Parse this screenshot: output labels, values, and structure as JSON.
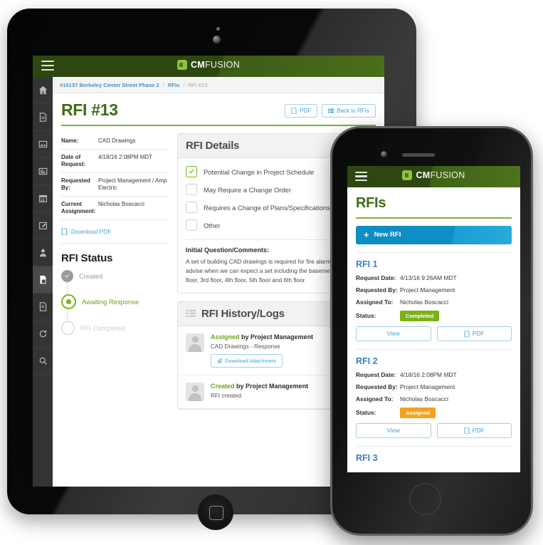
{
  "brand": {
    "name_bold": "CM",
    "name_light": "FUSION",
    "green_dark": "#2e4710",
    "green_accent": "#7fb03a",
    "blue": "#45a3d8",
    "orange": "#f5a11d"
  },
  "tablet": {
    "topbar": {
      "menu_icon": "hamburger-icon",
      "logo_icon": "cmfusion-logo-icon"
    },
    "sidebar": [
      {
        "name": "home",
        "icon": "home-icon",
        "active": false
      },
      {
        "name": "documents",
        "icon": "document-icon",
        "active": false
      },
      {
        "name": "photos",
        "icon": "image-icon",
        "active": false
      },
      {
        "name": "submittals",
        "icon": "list-icon",
        "active": false
      },
      {
        "name": "schedule",
        "icon": "calendar-icon",
        "active": false
      },
      {
        "name": "daily-logs",
        "icon": "edit-icon",
        "active": false
      },
      {
        "name": "contacts",
        "icon": "user-icon",
        "active": false
      },
      {
        "name": "rfis",
        "icon": "rfi-icon",
        "active": true
      },
      {
        "name": "forms",
        "icon": "file-icon",
        "active": false
      },
      {
        "name": "change-orders",
        "icon": "refresh-icon",
        "active": false
      },
      {
        "name": "search",
        "icon": "search-icon",
        "active": false
      }
    ],
    "breadcrumb": {
      "project": "#15137 Berkeley Center Street Phase 2",
      "section": "RFIs",
      "current": "RFI #13",
      "separator": "/"
    },
    "page_title": "RFI #13",
    "header_buttons": [
      {
        "label": "PDF",
        "icon": "pdf-icon"
      },
      {
        "label": "Back to RFIs",
        "icon": "list-icon"
      }
    ],
    "details": [
      {
        "key": "Name:",
        "value": "CAD Drawings"
      },
      {
        "key": "Date of Request:",
        "value": "4/18/16 2:08PM MDT"
      },
      {
        "key": "Requested By:",
        "value": "Project Management / Amp Electric"
      },
      {
        "key": "Current Assignment:",
        "value": "Nicholas Boscacci"
      }
    ],
    "download_pdf_label": "Download PDF",
    "status_title": "RFI Status",
    "status_steps": [
      {
        "label": "Created",
        "state": "done"
      },
      {
        "label": "Awaiting Response",
        "state": "current"
      },
      {
        "label": "RFI Completed",
        "state": "todo"
      }
    ],
    "rfi_details": {
      "panel_title": "RFI Details",
      "checkboxes": [
        {
          "label": "Potential Change in Project Schedule",
          "checked": true
        },
        {
          "label": "May Require a Change Order",
          "checked": false
        },
        {
          "label": "Requires a Change of Plans/Specifications",
          "checked": false
        },
        {
          "label": "Other",
          "checked": false
        }
      ],
      "question_heading": "Initial Question/Comments:",
      "question_text": "A set of building CAD drawings is required for fire alarm design, please advise when we can expect a set including the basement, 1st floor, 2nd floor, 3rd floor, 4th floor, 5th floor and 6th floor."
    },
    "history": {
      "panel_title": "RFI History/Logs",
      "panel_icon": "list-icon",
      "entries": [
        {
          "action": "Assigned",
          "by_text": "by Project Management",
          "detail": "CAD Drawings - Response",
          "attachment_label": "Download Attachment",
          "attachment_icon": "paperclip-icon"
        },
        {
          "action": "Created",
          "by_text": "by Project Management",
          "detail": "RFI created.",
          "attachment_label": null
        }
      ]
    }
  },
  "phone": {
    "topbar": {
      "menu_icon": "hamburger-icon",
      "logo_icon": "cmfusion-logo-icon"
    },
    "page_title": "RFIs",
    "new_button": {
      "label": "New RFI",
      "icon": "plus-icon"
    },
    "field_labels": {
      "request_date": "Request Date:",
      "requested_by": "Requested By:",
      "assigned_to": "Assigned To:",
      "status": "Status:"
    },
    "buttons": {
      "view": "View",
      "pdf": "PDF",
      "pdf_icon": "pdf-icon"
    },
    "items": [
      {
        "title": "RFI 1",
        "request_date": "4/13/16 9:26AM MDT",
        "requested_by": "Project Management",
        "assigned_to": "Nicholas Boscacci",
        "status": "Completed",
        "status_color": "#7ab317"
      },
      {
        "title": "RFI 2",
        "request_date": "4/18/16 2:08PM MDT",
        "requested_by": "Project Management",
        "assigned_to": "Nicholas Boscacci",
        "status": "Assigned",
        "status_color": "#f5a11d"
      },
      {
        "title": "RFI 3",
        "request_date": "",
        "requested_by": "",
        "assigned_to": "",
        "status": "",
        "status_color": "#7ab317"
      }
    ]
  }
}
